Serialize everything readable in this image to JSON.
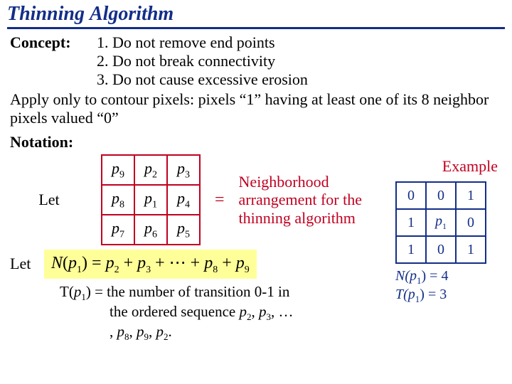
{
  "title": "Thinning Algorithm",
  "concept_label": "Concept:",
  "concept1": "1. Do not remove end points",
  "concept2": "2. Do not break connectivity",
  "concept3": "3. Do not cause excessive erosion",
  "apply": "Apply only to contour pixels: pixels “1” having at least one of its 8 neighbor pixels valued “0”",
  "notation_label": "Notation:",
  "let": "Let",
  "ptab": {
    "r0c0": "p",
    "r0c0s": "9",
    "r0c1": "p",
    "r0c1s": "2",
    "r0c2": "p",
    "r0c2s": "3",
    "r1c0": "p",
    "r1c0s": "8",
    "r1c1": "p",
    "r1c1s": "1",
    "r1c2": "p",
    "r1c2s": "4",
    "r2c0": "p",
    "r2c0s": "7",
    "r2c1": "p",
    "r2c1s": "6",
    "r2c2": "p",
    "r2c2s": "5"
  },
  "equals": "=",
  "nbdesc": "Neighborhood arrangement for the thinning algorithm",
  "example_label": "Example",
  "let2": "Let",
  "formula": {
    "N": "N",
    "lp": "(",
    "p": "p",
    "s1": "1",
    "rp": ")",
    "eq": " = ",
    "p2": "p",
    "s2": "2",
    "plus": " + ",
    "p3": "p",
    "s3": "3",
    "ellip": " + ⋯ + ",
    "p8": "p",
    "s8": "8",
    "p9": "p",
    "s9": "9"
  },
  "trans_line1_a": "T(",
  "trans_line1_p": "p",
  "trans_line1_s": "1",
  "trans_line1_b": ") = the number of transition 0-1 in",
  "trans_line2_a": "the ordered sequence ",
  "trans_line2_p2": "p",
  "trans_line2_s2": "2",
  "trans_line2_c": ", ",
  "trans_line2_p3": "p",
  "trans_line2_s3": "3",
  "trans_line2_d": ", …",
  "trans_line3_a": ", ",
  "trans_line3_p8": "p",
  "trans_line3_s8": "8",
  "trans_line3_c": ", ",
  "trans_line3_p9": "p",
  "trans_line3_s9": "9",
  "trans_line3_d": ", ",
  "trans_line3_p2": "p",
  "trans_line3_s2b": "2",
  "trans_line3_e": ".",
  "extab": {
    "r0c0": "0",
    "r0c1": "0",
    "r0c2": "1",
    "r1c0": "1",
    "r1c1p": "p",
    "r1c1s": "1",
    "r1c2": "0",
    "r2c0": "1",
    "r2c1": "0",
    "r2c2": "1"
  },
  "results": {
    "n_label": "N(",
    "p": "p",
    "s": "1",
    "n_close": ") = 4",
    "t_label": "T(",
    "t_close": ") = 3"
  }
}
